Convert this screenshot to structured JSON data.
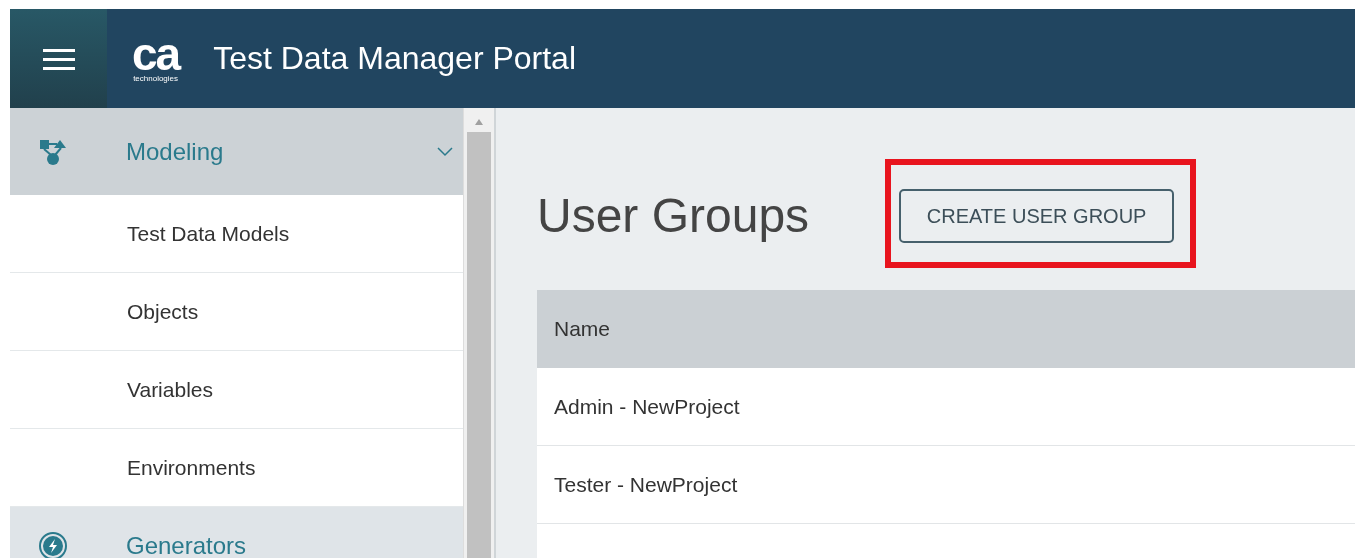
{
  "header": {
    "logo": {
      "mark": "ca",
      "caption": "technologies"
    },
    "title": "Test Data Manager Portal"
  },
  "sidebar": {
    "sections": [
      {
        "label": "Modeling",
        "expanded": true,
        "children": [
          {
            "label": "Test Data Models"
          },
          {
            "label": "Objects"
          },
          {
            "label": "Variables"
          },
          {
            "label": "Environments"
          }
        ]
      },
      {
        "label": "Generators",
        "expanded": false
      }
    ]
  },
  "main": {
    "title": "User Groups",
    "button": {
      "label": "CREATE USER GROUP",
      "highlighted": true
    },
    "table": {
      "columns": [
        "Name"
      ],
      "rows": [
        [
          "Admin - NewProject"
        ],
        [
          "Tester - NewProject"
        ]
      ]
    }
  }
}
